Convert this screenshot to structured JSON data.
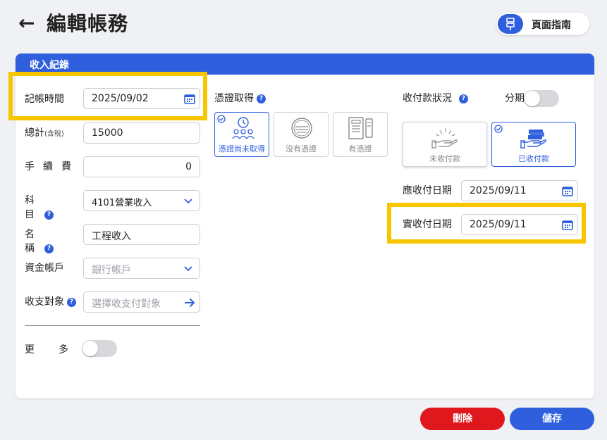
{
  "header": {
    "back_glyph": "←",
    "title": "編輯帳務",
    "guide_label": "頁面指南"
  },
  "card": {
    "title": "收入紀錄"
  },
  "left": {
    "record_time_label": "記帳時間",
    "record_time_value": "2025/09/02",
    "total_label": "總計",
    "total_sub": "(含稅)",
    "total_value": "15000",
    "fee_label": "手續費",
    "fee_value": "0",
    "subject_label": "科目",
    "subject_value": "4101營業收入",
    "name_label": "名稱",
    "name_value": "工程收入",
    "account_label": "資金帳戶",
    "account_placeholder": "銀行帳戶",
    "target_label": "收支對象",
    "target_placeholder": "選擇收支付對象",
    "more_label": "更多"
  },
  "middle": {
    "voucher_label": "憑證取得",
    "options": [
      {
        "label": "憑證尚未取得",
        "selected": true,
        "icon": "people-clock-icon"
      },
      {
        "label": "沒有憑證",
        "selected": false,
        "icon": "stamp-icon"
      },
      {
        "label": "有憑證",
        "selected": false,
        "icon": "receipt-icon"
      }
    ]
  },
  "right": {
    "status_label": "收付款狀況",
    "installment_label": "分期",
    "pay_options": [
      {
        "label": "未收付款",
        "selected": false,
        "icon": "open-hand-icon"
      },
      {
        "label": "已收付款",
        "selected": true,
        "icon": "hand-money-icon"
      }
    ],
    "due_date_label": "應收付日期",
    "due_date_value": "2025/09/11",
    "actual_date_label": "實收付日期",
    "actual_date_value": "2025/09/11"
  },
  "footer": {
    "delete_label": "刪除",
    "save_label": "儲存"
  },
  "colors": {
    "primary": "#2f5fdc",
    "danger": "#e0171d",
    "highlight": "#f7c600"
  }
}
